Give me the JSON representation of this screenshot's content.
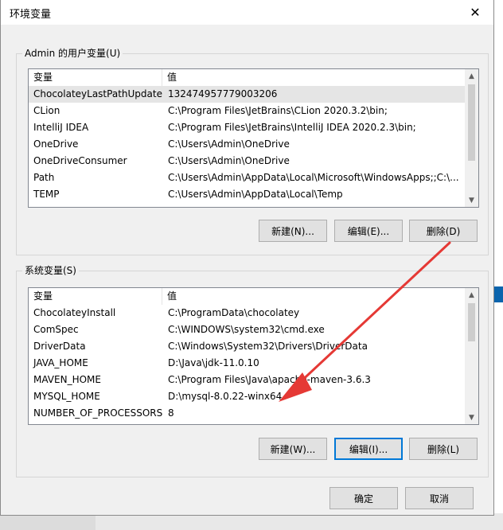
{
  "window": {
    "title": "环境变量"
  },
  "user_vars": {
    "label": "Admin 的用户变量(U)",
    "columns": [
      "变量",
      "值"
    ],
    "rows": [
      {
        "name": "ChocolateyLastPathUpdate",
        "value": "132474957779003206"
      },
      {
        "name": "CLion",
        "value": "C:\\Program Files\\JetBrains\\CLion 2020.3.2\\bin;"
      },
      {
        "name": "IntelliJ IDEA",
        "value": "C:\\Program Files\\JetBrains\\IntelliJ IDEA 2020.2.3\\bin;"
      },
      {
        "name": "OneDrive",
        "value": "C:\\Users\\Admin\\OneDrive"
      },
      {
        "name": "OneDriveConsumer",
        "value": "C:\\Users\\Admin\\OneDrive"
      },
      {
        "name": "Path",
        "value": "C:\\Users\\Admin\\AppData\\Local\\Microsoft\\WindowsApps;;C:\\..."
      },
      {
        "name": "TEMP",
        "value": "C:\\Users\\Admin\\AppData\\Local\\Temp"
      }
    ],
    "buttons": {
      "new": "新建(N)...",
      "edit": "编辑(E)...",
      "delete": "删除(D)"
    }
  },
  "sys_vars": {
    "label": "系统变量(S)",
    "columns": [
      "变量",
      "值"
    ],
    "rows": [
      {
        "name": "ChocolateyInstall",
        "value": "C:\\ProgramData\\chocolatey"
      },
      {
        "name": "ComSpec",
        "value": "C:\\WINDOWS\\system32\\cmd.exe"
      },
      {
        "name": "DriverData",
        "value": "C:\\Windows\\System32\\Drivers\\DriverData"
      },
      {
        "name": "JAVA_HOME",
        "value": "D:\\Java\\jdk-11.0.10"
      },
      {
        "name": "MAVEN_HOME",
        "value": "C:\\Program Files\\Java\\apache-maven-3.6.3"
      },
      {
        "name": "MYSQL_HOME",
        "value": "D:\\mysql-8.0.22-winx64"
      },
      {
        "name": "NUMBER_OF_PROCESSORS",
        "value": "8"
      }
    ],
    "buttons": {
      "new": "新建(W)...",
      "edit": "编辑(I)...",
      "delete": "删除(L)"
    }
  },
  "dialog_buttons": {
    "ok": "确定",
    "cancel": "取消"
  },
  "annotation": {
    "arrow_color": "#e53935"
  },
  "icons": {
    "close": "close-icon",
    "scroll_up": "chevron-up-icon",
    "scroll_down": "chevron-down-icon"
  }
}
